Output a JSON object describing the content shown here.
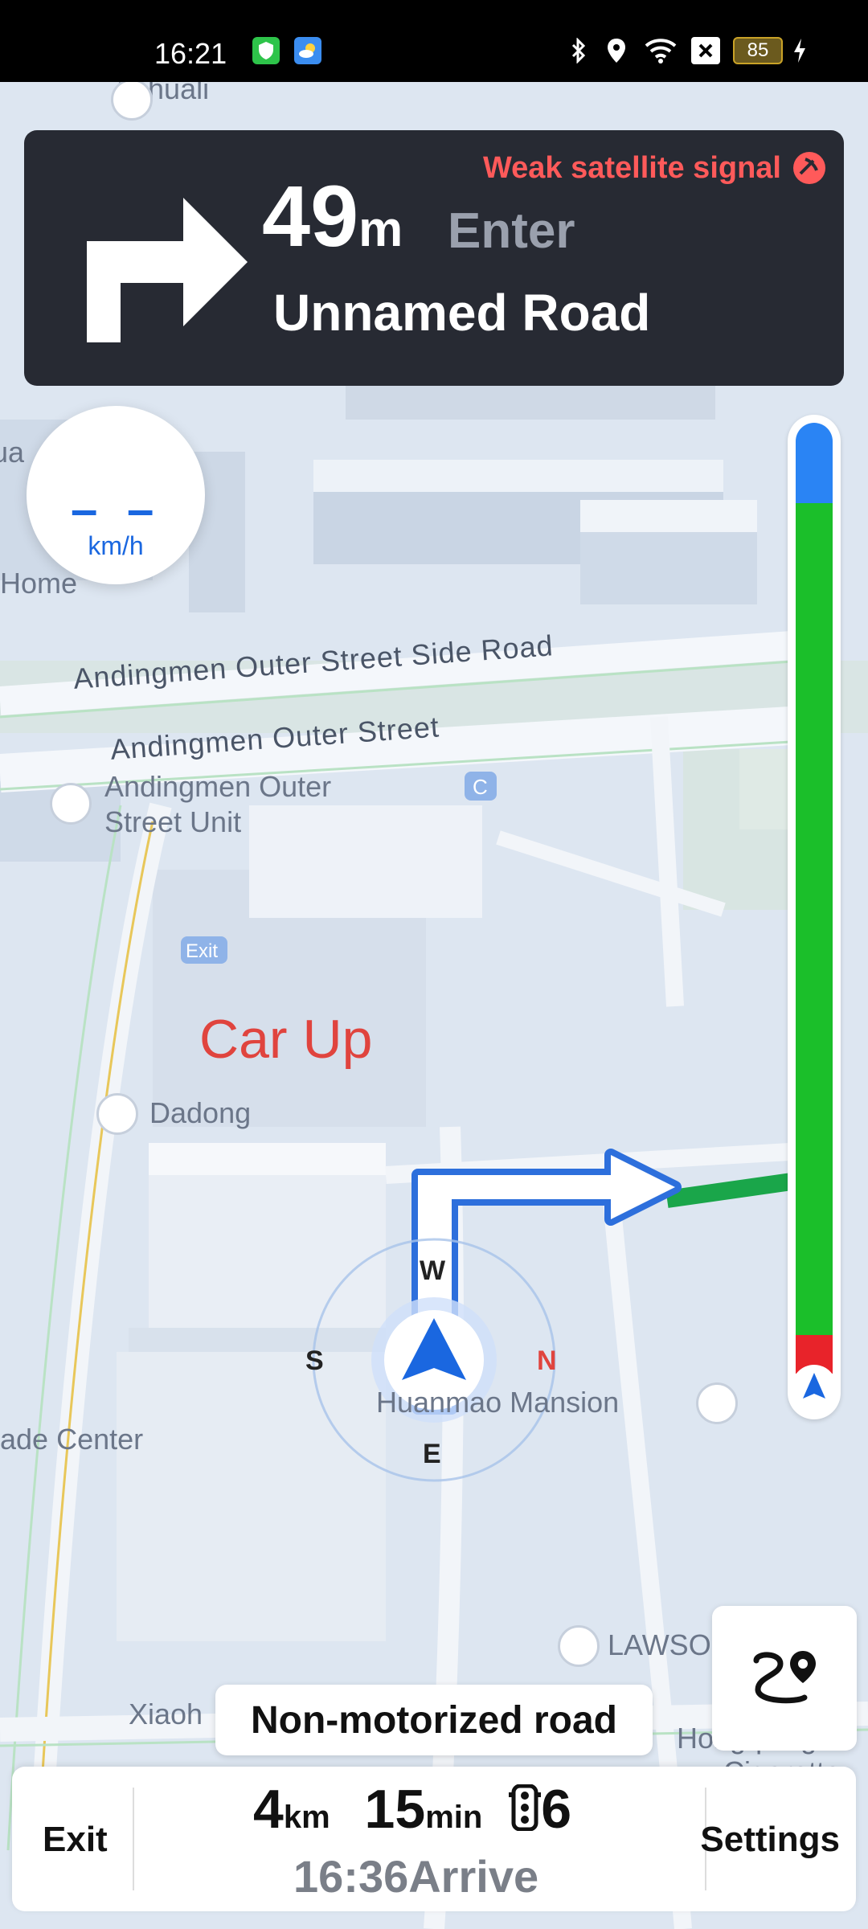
{
  "status_bar": {
    "time": "16:21",
    "battery": "85"
  },
  "guidance": {
    "distance_value": "49",
    "distance_unit": "m",
    "action": "Enter",
    "road_name": "Unnamed Road",
    "signal_warning": "Weak satellite signal"
  },
  "speed": {
    "value": "– –",
    "unit": "km/h"
  },
  "map": {
    "labels": {
      "anhuali": "Anhuali",
      "home": "Home",
      "ua": "ua",
      "side_road": "Andingmen Outer Street Side Road",
      "outer_street": "Andingmen Outer Street",
      "unit_line1": "Andingmen Outer",
      "unit_line2": "Street Unit",
      "exit": "Exit",
      "car_up": "Car Up",
      "dadong": "Dadong",
      "mansion": "Huanmao Mansion",
      "trade_center": "ade Center",
      "lawson": "LAWSO",
      "xiaoh": "Xiaoh",
      "hongqiang": "Hongqiang W",
      "cigarette": "Cigarette",
      "c_badge": "C"
    },
    "compass": {
      "w": "W",
      "s": "S",
      "n": "N",
      "e": "E"
    }
  },
  "road_type": "Non-motorized road",
  "trip": {
    "distance": "4",
    "distance_unit": "km",
    "duration": "15",
    "duration_unit": "min",
    "traffic_lights": "6",
    "arrive_time": "16:36Arrive"
  },
  "buttons": {
    "exit": "Exit",
    "settings": "Settings"
  },
  "colors": {
    "guide_bg": "#272a33",
    "warning": "#ff5a5a",
    "accent_blue": "#1a67e0",
    "traffic_green": "#1bbf2a",
    "traffic_red": "#e8232a"
  },
  "icons": {
    "turn": "turn-right-arrow-icon",
    "signal": "satellite-signal-icon",
    "route": "route-overview-icon",
    "traffic_light": "traffic-light-icon",
    "navigation": "navigation-arrow-icon"
  }
}
